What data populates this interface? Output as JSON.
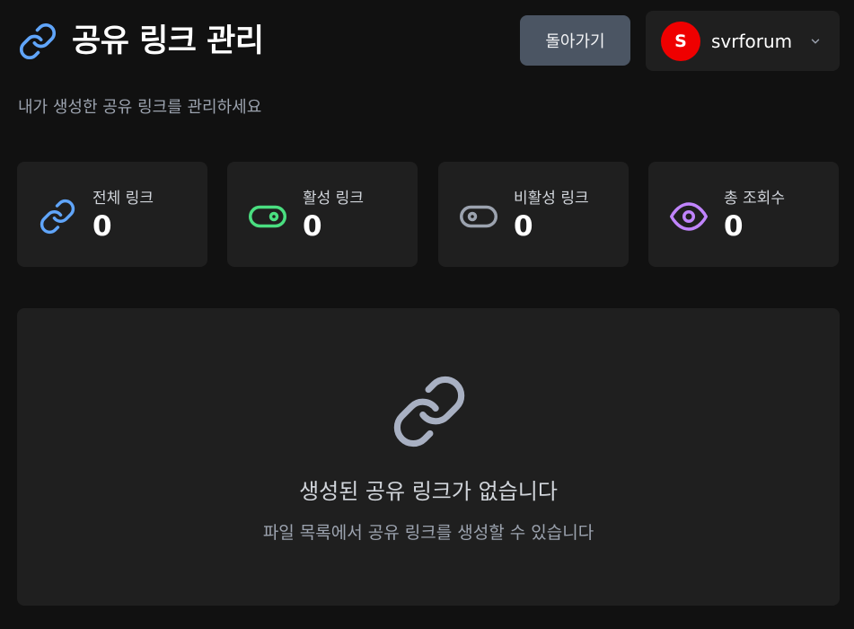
{
  "header": {
    "title": "공유 링크 관리",
    "subtitle": "내가 생성한 공유 링크를 관리하세요",
    "back_label": "돌아가기"
  },
  "user": {
    "avatar_letter": "S",
    "name": "svrforum",
    "avatar_color": "#ef0000"
  },
  "stats": [
    {
      "label": "전체 링크",
      "value": "0",
      "icon": "link-icon",
      "color": "#60a5fa"
    },
    {
      "label": "활성 링크",
      "value": "0",
      "icon": "toggle-on-icon",
      "color": "#4ade80"
    },
    {
      "label": "비활성 링크",
      "value": "0",
      "icon": "toggle-off-icon",
      "color": "#9ca3af"
    },
    {
      "label": "총 조회수",
      "value": "0",
      "icon": "eye-icon",
      "color": "#c084fc"
    }
  ],
  "empty_state": {
    "title": "생성된 공유 링크가 없습니다",
    "description": "파일 목록에서 공유 링크를 생성할 수 있습니다",
    "icon": "link-icon"
  },
  "colors": {
    "background": "#111111",
    "card": "#1f1f1f",
    "button": "#4b5563"
  }
}
